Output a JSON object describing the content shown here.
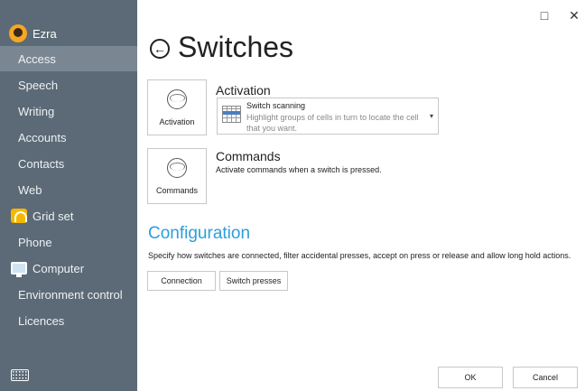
{
  "window": {
    "maximize_icon": "□",
    "close_icon": "✕"
  },
  "sidebar": {
    "user": {
      "name": "Ezra"
    },
    "items": [
      {
        "label": "Access",
        "active": true
      },
      {
        "label": "Speech"
      },
      {
        "label": "Writing"
      },
      {
        "label": "Accounts"
      },
      {
        "label": "Contacts"
      },
      {
        "label": "Web"
      },
      {
        "label": "Grid set",
        "icon": "grid-set-icon"
      },
      {
        "label": "Phone"
      },
      {
        "label": "Computer",
        "icon": "computer-icon"
      },
      {
        "label": "Environment control"
      },
      {
        "label": "Licences"
      }
    ],
    "keyboard_icon": "keyboard-icon"
  },
  "header": {
    "back_icon": "←",
    "title": "Switches"
  },
  "activation": {
    "tile_label": "Activation",
    "heading": "Activation",
    "dropdown": {
      "title": "Switch scanning",
      "description": "Highlight groups of cells in turn to locate the cell that you want.",
      "chevron": "▾"
    }
  },
  "commands": {
    "tile_label": "Commands",
    "heading": "Commands",
    "description": "Activate commands when a switch is pressed."
  },
  "configuration": {
    "title": "Configuration",
    "description": "Specify how switches are connected, filter accidental presses, accept on press or release and allow long hold actions.",
    "buttons": {
      "connection": "Connection",
      "switch_presses": "Switch presses"
    }
  },
  "footer": {
    "ok": "OK",
    "cancel": "Cancel"
  },
  "colors": {
    "sidebar": "#5b6a76",
    "sidebar_active": "#7a8792",
    "accent": "#2e9ed8"
  }
}
